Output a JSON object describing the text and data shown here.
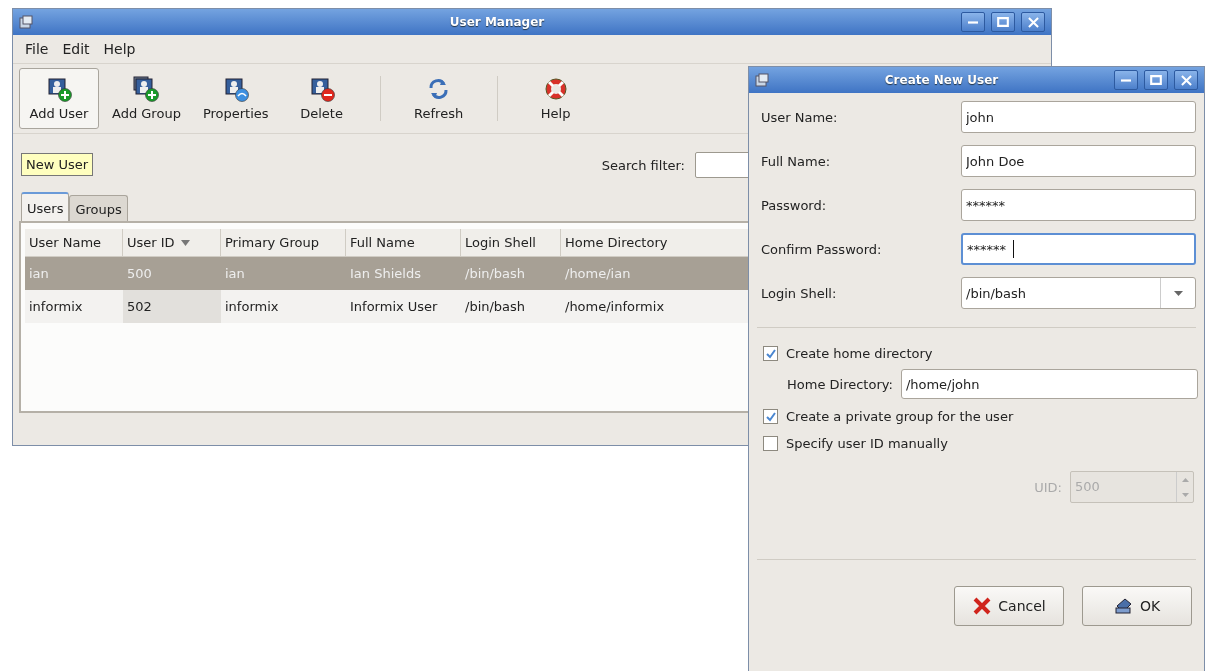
{
  "main_window": {
    "title": "User Manager",
    "menu": [
      "File",
      "Edit",
      "Help"
    ],
    "toolbar": [
      {
        "label": "Add User",
        "kind": "add-user",
        "hovered": true
      },
      {
        "label": "Add Group",
        "kind": "add-group",
        "hovered": false
      },
      {
        "label": "Properties",
        "kind": "properties",
        "hovered": false
      },
      {
        "label": "Delete",
        "kind": "delete",
        "hovered": false
      },
      {
        "label": "Refresh",
        "kind": "refresh",
        "hovered": false
      },
      {
        "label": "Help",
        "kind": "help",
        "hovered": false
      }
    ],
    "tooltip": "New User",
    "search": {
      "label": "Search filter:"
    },
    "tabs": [
      {
        "label": "Users",
        "selected": true
      },
      {
        "label": "Groups",
        "selected": false
      }
    ],
    "table": {
      "columns": [
        {
          "label": "User Name",
          "sorted": false
        },
        {
          "label": "User ID",
          "sorted": true
        },
        {
          "label": "Primary Group",
          "sorted": false
        },
        {
          "label": "Full Name",
          "sorted": false
        },
        {
          "label": "Login Shell",
          "sorted": false
        },
        {
          "label": "Home Directory",
          "sorted": false
        }
      ],
      "rows": [
        {
          "selected": true,
          "cells": [
            "ian",
            "500",
            "ian",
            "Ian Shields",
            "/bin/bash",
            "/home/ian"
          ]
        },
        {
          "selected": false,
          "cells": [
            "informix",
            "502",
            "informix",
            "Informix User",
            "/bin/bash",
            "/home/informix"
          ]
        }
      ]
    }
  },
  "dialog": {
    "title": "Create New User",
    "fields": [
      {
        "label": "User Name:",
        "kind": "text",
        "value": "john",
        "focused": false
      },
      {
        "label": "Full Name:",
        "kind": "text",
        "value": "John Doe",
        "focused": false
      },
      {
        "label": "Password:",
        "kind": "password",
        "value": "******",
        "focused": false
      },
      {
        "label": "Confirm Password:",
        "kind": "password",
        "value": "******",
        "focused": true
      },
      {
        "label": "Login Shell:",
        "kind": "combo",
        "value": "/bin/bash",
        "focused": false
      }
    ],
    "create_home": {
      "label": "Create home directory",
      "checked": true
    },
    "home_directory": {
      "label": "Home Directory:",
      "value": "/home/john"
    },
    "private_group": {
      "label": "Create a private group for the user",
      "checked": true
    },
    "specify_uid": {
      "label": "Specify user ID manually",
      "checked": false
    },
    "uid": {
      "label": "UID:",
      "value": "500",
      "disabled": true
    },
    "buttons": [
      {
        "label": "Cancel",
        "kind": "cancel"
      },
      {
        "label": "OK",
        "kind": "ok"
      }
    ]
  }
}
